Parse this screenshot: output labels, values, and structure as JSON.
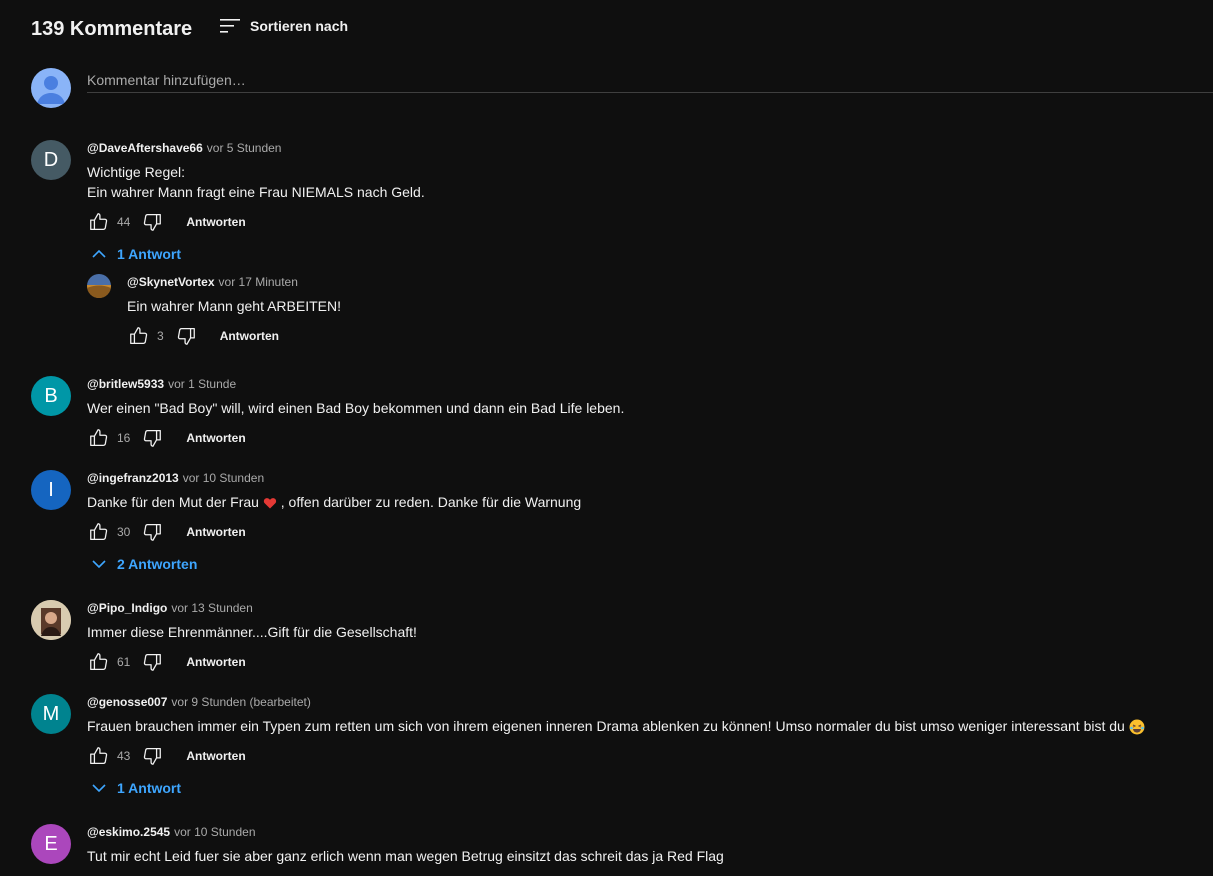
{
  "header": {
    "count": "139 Kommentare",
    "sort_label": "Sortieren nach"
  },
  "add_comment": {
    "placeholder": "Kommentar hinzufügen…"
  },
  "comments": [
    {
      "avatar_letter": "D",
      "avatar_color": "#455a64",
      "author": "@DaveAftershave66",
      "time": "vor 5 Stunden",
      "text_line1": "Wichtige Regel:",
      "text_line2": "Ein wahrer Mann fragt eine Frau NIEMALS nach Geld.",
      "likes": "44",
      "reply_label": "Antworten"
    },
    {
      "avatar_letter": "B",
      "avatar_color": "#0097a7",
      "author": "@britlew5933",
      "time": "vor 1 Stunde",
      "text": "Wer einen \"Bad Boy\" will, wird einen Bad Boy bekommen und dann ein Bad Life leben.",
      "likes": "16",
      "reply_label": "Antworten"
    },
    {
      "avatar_letter": "I",
      "avatar_color": "#1565c0",
      "author": "@ingefranz2013",
      "time": "vor 10 Stunden",
      "text_before": "Danke für den Mut der Frau ",
      "text_after": " , offen darüber zu reden. Danke für die Warnung",
      "likes": "30",
      "reply_label": "Antworten"
    },
    {
      "author": "@Pipo_Indigo",
      "time": "vor 13 Stunden",
      "text": "Immer diese Ehrenmänner....Gift für die Gesellschaft!",
      "likes": "61",
      "reply_label": "Antworten"
    },
    {
      "avatar_letter": "M",
      "avatar_color": "#00838f",
      "author": "@genosse007",
      "time": "vor 9 Stunden (bearbeitet)",
      "text": "Frauen brauchen immer ein Typen zum retten um sich von ihrem eigenen inneren Drama ablenken zu können! Umso normaler du bist umso weniger interessant bist du ",
      "likes": "43",
      "reply_label": "Antworten"
    },
    {
      "avatar_letter": "E",
      "avatar_color": "#ab47bc",
      "author": "@eskimo.2545",
      "time": "vor 10 Stunden",
      "text": "Tut mir echt Leid fuer sie aber ganz erlich  wenn man wegen Betrug einsitzt das schreit das ja Red Flag"
    }
  ],
  "reply": {
    "author": "@SkynetVortex",
    "time": "vor 17 Minuten",
    "text": "Ein wahrer Mann geht ARBEITEN!",
    "likes": "3",
    "reply_label": "Antworten"
  },
  "toggles": {
    "t1": "1 Antwort",
    "t2": "2 Antworten",
    "t3": "1 Antwort"
  },
  "colors": {
    "background": "#0f0f0f",
    "link_blue": "#3ea6ff",
    "secondary_text": "#aaaaaa"
  },
  "icons": [
    "sort-icon",
    "thumb-up-icon",
    "thumb-down-icon",
    "chevron-up-icon",
    "chevron-down-icon",
    "heart-icon",
    "laughing-emoji-icon"
  ]
}
